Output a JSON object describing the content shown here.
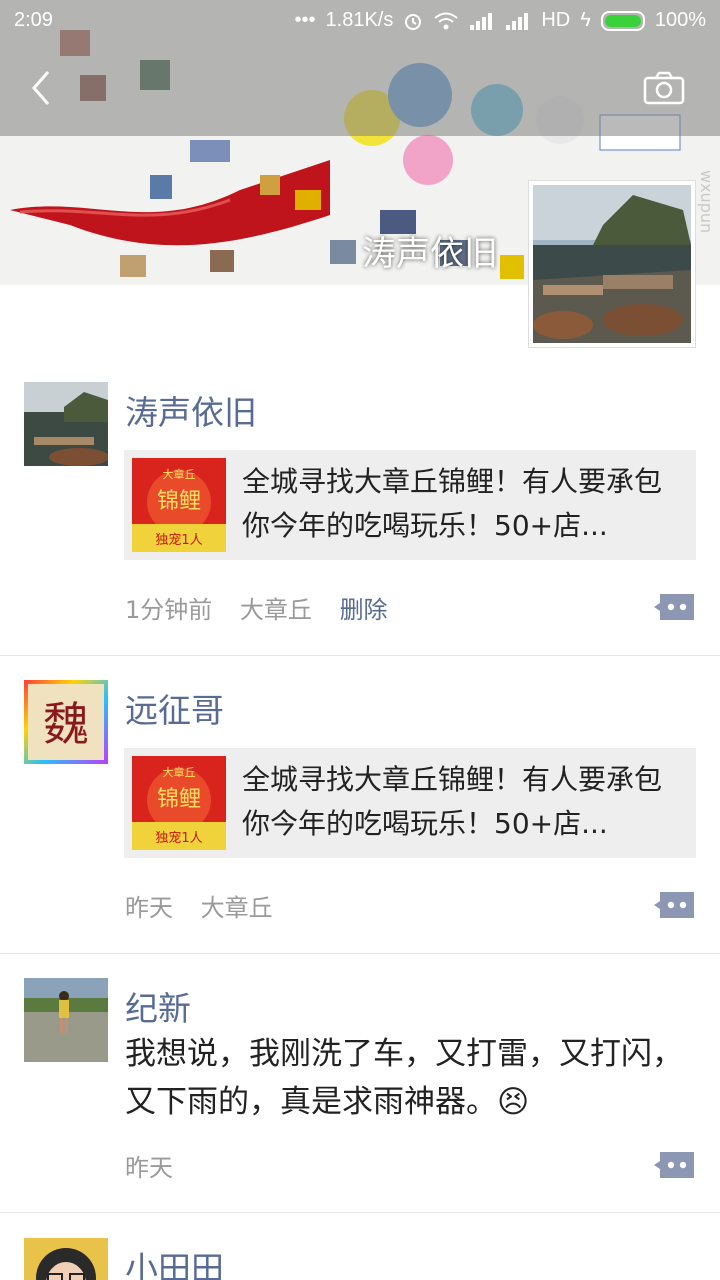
{
  "status": {
    "time": "2:09",
    "network_speed": "1.81K/s",
    "hd": "HD",
    "battery": "100%",
    "battery_level": 1.0
  },
  "cover": {
    "name": "涛声依旧",
    "watermark": "wxupun"
  },
  "posts": [
    {
      "nickname": "涛声依旧",
      "share_title": "全城寻找大章丘锦鲤！有人要承包你今年的吃喝玩乐！50+店...",
      "share_thumb": {
        "top": "大章丘",
        "main": "锦鲤",
        "bottom": "独宠1人"
      },
      "time": "1分钟前",
      "location": "大章丘",
      "delete": "删除"
    },
    {
      "nickname": "远征哥",
      "avatar_char": "魏",
      "share_title": "全城寻找大章丘锦鲤！有人要承包你今年的吃喝玩乐！50+店...",
      "share_thumb": {
        "top": "大章丘",
        "main": "锦鲤",
        "bottom": "独宠1人"
      },
      "time": "昨天",
      "location": "大章丘"
    },
    {
      "nickname": "纪新",
      "text": "我想说，我刚洗了车，又打雷，又打闪，又下雨的，真是求雨神器。😣",
      "time": "昨天"
    },
    {
      "nickname": "小田田"
    }
  ],
  "colors": {
    "link": "#576b95",
    "meta": "#9a9a9a",
    "share_bg": "#eeeeee"
  },
  "icons": [
    "back-icon",
    "camera-icon",
    "comment-icon",
    "wifi-icon",
    "signal-icon",
    "alarm-icon",
    "battery-icon"
  ]
}
